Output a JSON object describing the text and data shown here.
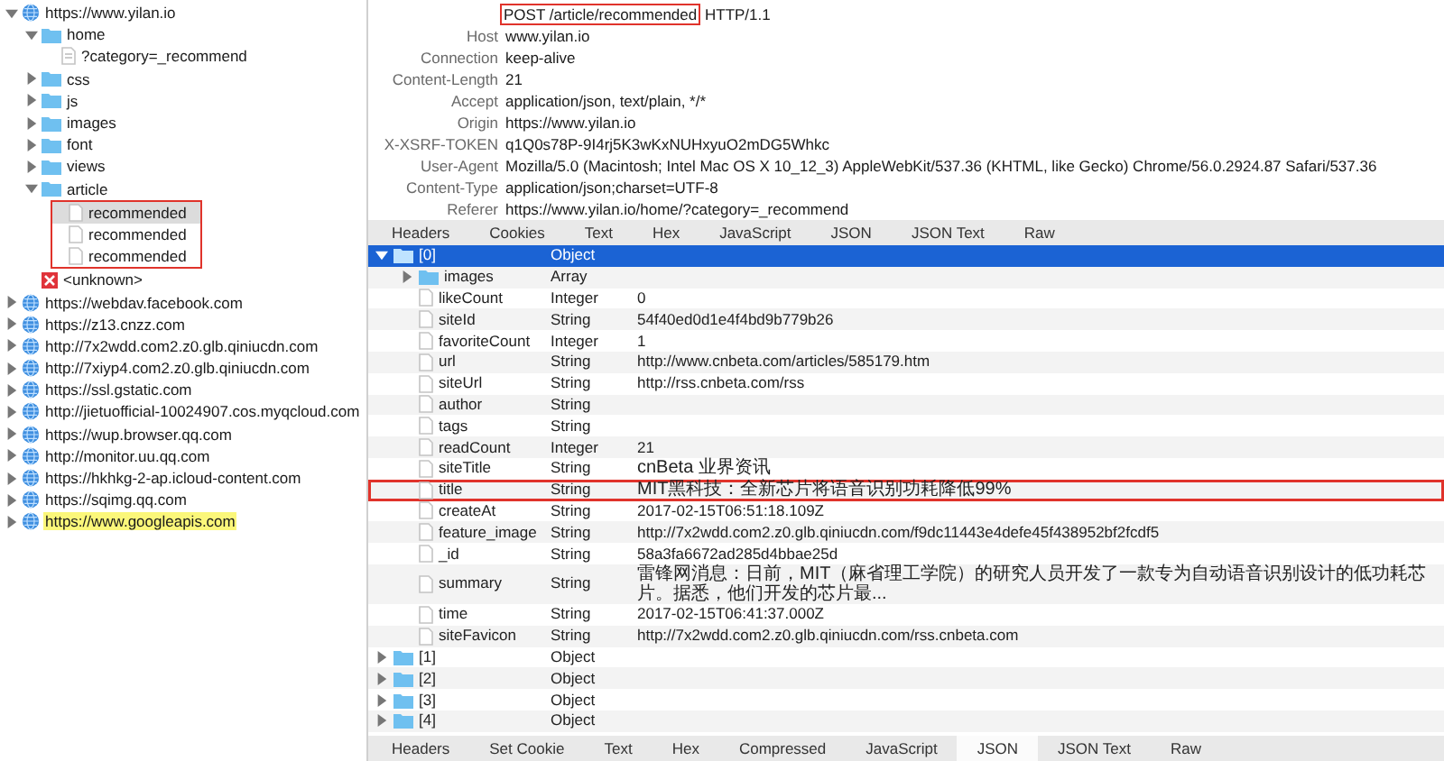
{
  "host_tree": [
    {
      "kind": "host",
      "label": "https://www.yilan.io",
      "expanded": true,
      "selected": false,
      "highlighted": false,
      "children": [
        {
          "kind": "folder",
          "label": "home",
          "expanded": true,
          "selected": false,
          "children": [
            {
              "kind": "query",
              "label": "?category=_recommend",
              "selected": false
            }
          ]
        },
        {
          "kind": "folder",
          "label": "css",
          "expanded": false,
          "selected": false
        },
        {
          "kind": "folder",
          "label": "js",
          "expanded": false,
          "selected": false
        },
        {
          "kind": "folder",
          "label": "images",
          "expanded": false,
          "selected": false
        },
        {
          "kind": "folder",
          "label": "font",
          "expanded": false,
          "selected": false
        },
        {
          "kind": "folder",
          "label": "views",
          "expanded": false,
          "selected": false
        },
        {
          "kind": "folder",
          "label": "article",
          "expanded": true,
          "selected": false,
          "children_annotated": true,
          "children": [
            {
              "kind": "file",
              "label": "recommended",
              "selected": true
            },
            {
              "kind": "file",
              "label": "recommended",
              "selected": false
            },
            {
              "kind": "file",
              "label": "recommended",
              "selected": false
            }
          ]
        },
        {
          "kind": "error",
          "label": "<unknown>",
          "selected": false
        }
      ]
    },
    {
      "kind": "host",
      "label": "https://webdav.facebook.com",
      "expanded": false,
      "selected": false,
      "highlighted": false
    },
    {
      "kind": "host",
      "label": "https://z13.cnzz.com",
      "expanded": false,
      "selected": false,
      "highlighted": false
    },
    {
      "kind": "host",
      "label": "http://7x2wdd.com2.z0.glb.qiniucdn.com",
      "expanded": false,
      "selected": false,
      "highlighted": false
    },
    {
      "kind": "host",
      "label": "http://7xiyp4.com2.z0.glb.qiniucdn.com",
      "expanded": false,
      "selected": false,
      "highlighted": false
    },
    {
      "kind": "host",
      "label": "https://ssl.gstatic.com",
      "expanded": false,
      "selected": false,
      "highlighted": false
    },
    {
      "kind": "host",
      "label": "http://jietuofficial-10024907.cos.myqcloud.com",
      "expanded": false,
      "selected": false,
      "highlighted": false
    },
    {
      "kind": "host",
      "label": "https://wup.browser.qq.com",
      "expanded": false,
      "selected": false,
      "highlighted": false
    },
    {
      "kind": "host",
      "label": "http://monitor.uu.qq.com",
      "expanded": false,
      "selected": false,
      "highlighted": false
    },
    {
      "kind": "host",
      "label": "https://hkhkg-2-ap.icloud-content.com",
      "expanded": false,
      "selected": false,
      "highlighted": false
    },
    {
      "kind": "host",
      "label": "https://sqimg.qq.com",
      "expanded": false,
      "selected": false,
      "highlighted": false
    },
    {
      "kind": "host",
      "label": "https://www.googleapis.com",
      "expanded": false,
      "selected": false,
      "highlighted": true
    }
  ],
  "request_line": {
    "method": "POST",
    "path": "/article/recommended",
    "version": "HTTP/1.1",
    "annotated": true
  },
  "request_headers": [
    {
      "name": "Host",
      "value": "www.yilan.io"
    },
    {
      "name": "Connection",
      "value": "keep-alive"
    },
    {
      "name": "Content-Length",
      "value": "21"
    },
    {
      "name": "Accept",
      "value": "application/json, text/plain, */*"
    },
    {
      "name": "Origin",
      "value": "https://www.yilan.io"
    },
    {
      "name": "X-XSRF-TOKEN",
      "value": "q1Q0s78P-9I4rj5K3wKxNUHxyuO2mDG5Whkc"
    },
    {
      "name": "User-Agent",
      "value": "Mozilla/5.0 (Macintosh; Intel Mac OS X 10_12_3) AppleWebKit/537.36 (KHTML, like Gecko) Chrome/56.0.2924.87 Safari/537.36"
    },
    {
      "name": "Content-Type",
      "value": "application/json;charset=UTF-8"
    },
    {
      "name": "Referer",
      "value": "https://www.yilan.io/home/?category=_recommend"
    }
  ],
  "request_tabs": [
    {
      "label": "Headers",
      "selected": false
    },
    {
      "label": "Cookies",
      "selected": false
    },
    {
      "label": "Text",
      "selected": false
    },
    {
      "label": "Hex",
      "selected": false
    },
    {
      "label": "JavaScript",
      "selected": false
    },
    {
      "label": "JSON",
      "selected": false
    },
    {
      "label": "JSON Text",
      "selected": false
    },
    {
      "label": "Raw",
      "selected": false
    }
  ],
  "json_tree": [
    {
      "kind": "object",
      "name": "[0]",
      "type": "Object",
      "expanded": true,
      "selected": true,
      "children": [
        {
          "kind": "object",
          "name": "images",
          "type": "Array",
          "expanded": false,
          "selected": false
        },
        {
          "kind": "value",
          "name": "likeCount",
          "type": "Integer",
          "value": "0",
          "selected": false
        },
        {
          "kind": "value",
          "name": "siteId",
          "type": "String",
          "value": "54f40ed0d1e4f4bd9b779b26",
          "selected": false
        },
        {
          "kind": "value",
          "name": "favoriteCount",
          "type": "Integer",
          "value": "1",
          "selected": false
        },
        {
          "kind": "value",
          "name": "url",
          "type": "String",
          "value": "http://www.cnbeta.com/articles/585179.htm",
          "selected": false
        },
        {
          "kind": "value",
          "name": "siteUrl",
          "type": "String",
          "value": "http://rss.cnbeta.com/rss",
          "selected": false
        },
        {
          "kind": "value",
          "name": "author",
          "type": "String",
          "selected": false
        },
        {
          "kind": "value",
          "name": "tags",
          "type": "String",
          "selected": false
        },
        {
          "kind": "value",
          "name": "readCount",
          "type": "Integer",
          "value": "21",
          "selected": false
        },
        {
          "kind": "value",
          "name": "siteTitle",
          "type": "String",
          "value": "cnBeta 业界资讯",
          "selected": false
        },
        {
          "kind": "value",
          "name": "title",
          "type": "String",
          "value": "MIT黑科技：全新芯片将语音识别功耗降低99%",
          "selected": false,
          "annotated": true
        },
        {
          "kind": "value",
          "name": "createAt",
          "type": "String",
          "value": "2017-02-15T06:51:18.109Z",
          "selected": false
        },
        {
          "kind": "value",
          "name": "feature_image",
          "type": "String",
          "value": "http://7x2wdd.com2.z0.glb.qiniucdn.com/f9dc11443e4defe45f438952bf2fcdf5",
          "selected": false
        },
        {
          "kind": "value",
          "name": "_id",
          "type": "String",
          "value": "58a3fa6672ad285d4bbae25d",
          "selected": false
        },
        {
          "kind": "value",
          "name": "summary",
          "type": "String",
          "value": "雷锋网消息：日前，MIT（麻省理工学院）的研究人员开发了一款专为自动语音识别设计的低功耗芯片。据悉，他们开发的芯片最...",
          "selected": false
        },
        {
          "kind": "value",
          "name": "time",
          "type": "String",
          "value": "2017-02-15T06:41:37.000Z",
          "selected": false
        },
        {
          "kind": "value",
          "name": "siteFavicon",
          "type": "String",
          "value": "http://7x2wdd.com2.z0.glb.qiniucdn.com/rss.cnbeta.com",
          "selected": false
        }
      ]
    },
    {
      "kind": "object",
      "name": "[1]",
      "type": "Object",
      "expanded": false,
      "selected": false
    },
    {
      "kind": "object",
      "name": "[2]",
      "type": "Object",
      "expanded": false,
      "selected": false
    },
    {
      "kind": "object",
      "name": "[3]",
      "type": "Object",
      "expanded": false,
      "selected": false
    },
    {
      "kind": "object",
      "name": "[4]",
      "type": "Object",
      "expanded": false,
      "selected": false
    }
  ],
  "response_tabs": [
    {
      "label": "Headers",
      "selected": false
    },
    {
      "label": "Set Cookie",
      "selected": false
    },
    {
      "label": "Text",
      "selected": false
    },
    {
      "label": "Hex",
      "selected": false
    },
    {
      "label": "Compressed",
      "selected": false
    },
    {
      "label": "JavaScript",
      "selected": false
    },
    {
      "label": "JSON",
      "selected": true
    },
    {
      "label": "JSON Text",
      "selected": false
    },
    {
      "label": "Raw",
      "selected": false
    }
  ]
}
